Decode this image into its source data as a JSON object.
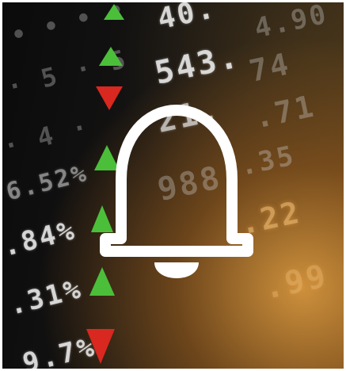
{
  "image": {
    "subject": "notification bell over stock ticker board",
    "colors": {
      "up_arrow": "#4bbf3a",
      "down_arrow": "#d8281f",
      "bell_stroke": "#ffffff",
      "glow": "#d69a3e"
    },
    "icon": "bell-icon"
  }
}
